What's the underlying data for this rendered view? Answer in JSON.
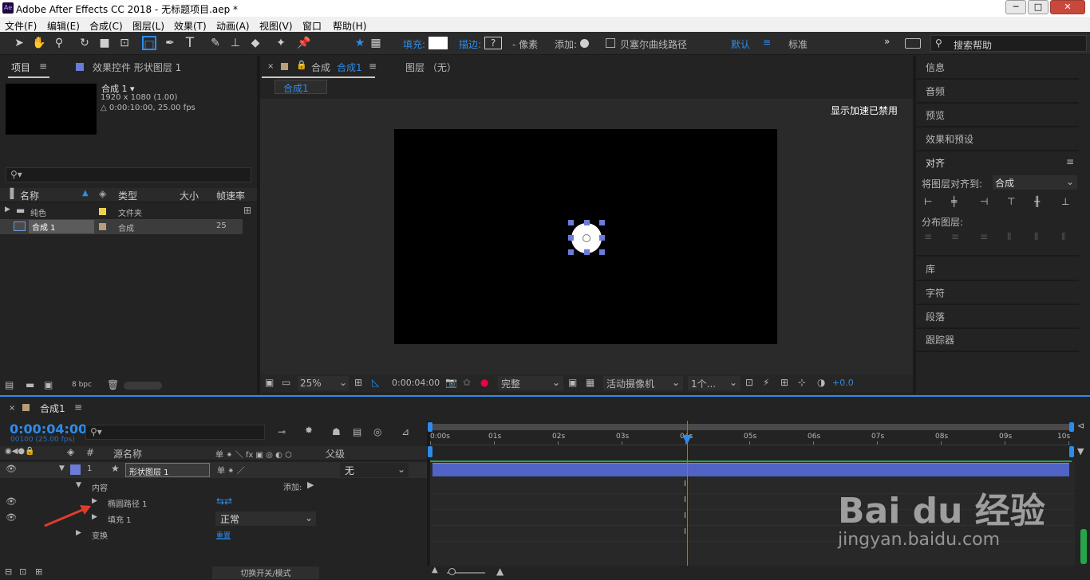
{
  "window": {
    "title": "Adobe After Effects CC 2018 - 无标题项目.aep *",
    "btn_min": "─",
    "btn_max": "□",
    "btn_close": "✕"
  },
  "menu": [
    "文件(F)",
    "编辑(E)",
    "合成(C)",
    "图层(L)",
    "效果(T)",
    "动画(A)",
    "视图(V)",
    "窗口",
    "帮助(H)"
  ],
  "toolbar": {
    "fill_label": "填充:",
    "stroke_label": "描边:",
    "stroke_value": "?",
    "pixels": "- 像素",
    "add_label": "添加:",
    "bezier": "贝塞尔曲线路径",
    "workspace_default": "默认",
    "workspace_standard": "标准",
    "search_placeholder": "搜索帮助"
  },
  "project": {
    "tab": "项目",
    "effects_tab": "效果控件 形状图层 1",
    "comp_name": "合成 1 ▾",
    "comp_res": "1920 x 1080 (1.00)",
    "comp_dur": "△ 0:00:10:00, 25.00 fps",
    "columns": [
      "名称",
      "类型",
      "大小",
      "帧速率"
    ],
    "items": [
      {
        "name": "纯色",
        "type": "文件夹",
        "fps": "",
        "color": "#e8d34a"
      },
      {
        "name": "合成 1",
        "type": "合成",
        "fps": "25",
        "color": "#b79d7a"
      }
    ],
    "bpc": "8 bpc"
  },
  "viewer": {
    "tab_comp": "合成",
    "tab_comp_name": "合成1",
    "tab_layer": "图层 （无）",
    "sub_tab": "合成1",
    "accel_notice": "显示加速已禁用",
    "zoom": "25%",
    "timecode": "0:00:04:00",
    "quality": "完整",
    "camera": "活动摄像机",
    "views": "1个...",
    "exposure": "+0.0"
  },
  "right": {
    "info": "信息",
    "audio": "音频",
    "preview": "预览",
    "effects": "效果和预设",
    "align": "对齐",
    "align_to_label": "将图层对齐到:",
    "align_to_value": "合成",
    "distribute": "分布图层:",
    "library": "库",
    "character": "字符",
    "paragraph": "段落",
    "tracker": "跟踪器"
  },
  "timeline": {
    "tab": "合成1",
    "timecode": "0:00:04:00",
    "frames": "00100 (25.00 fps)",
    "col_num": "#",
    "col_source": "源名称",
    "col_switches": "单 ⁕ ＼ fx ▣ ◎ ◐ ⬡",
    "col_parent": "父级",
    "ruler": [
      "0:00s",
      "01s",
      "02s",
      "03s",
      "04s",
      "05s",
      "06s",
      "07s",
      "08s",
      "09s",
      "10s"
    ],
    "layer": {
      "num": "1",
      "name": "形状图层 1",
      "parent": "无"
    },
    "contents": "内容",
    "add_label": "添加:",
    "ellipse": "椭圆路径 1",
    "fill": "填充 1",
    "fill_mode": "正常",
    "transform": "变换",
    "reset": "重置",
    "toggle_modes": "切换开关/模式"
  },
  "watermark": {
    "brand": "Bai du 经验",
    "url": "jingyan.baidu.com"
  }
}
